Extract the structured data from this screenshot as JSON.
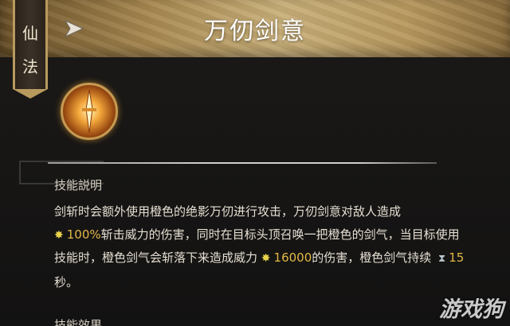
{
  "panel": {
    "title": "万仞剑意",
    "side_tab": {
      "char1": "仙",
      "char2": "法"
    }
  },
  "skill": {
    "icon": "sword-emblem-icon",
    "section_title": "技能説明",
    "desc": {
      "p1": "剑斩时会额外使用橙色的绝影万仞进行攻击，万仞剑意对敌人造成",
      "v1": "100%",
      "p2": "斩击威力的伤害，同时在目标头顶召唤一把橙色的剑气，当目标使用技能时，橙色剑气会斩落下来造成威力",
      "v2": "16000",
      "p3": "的伤害，橙色剑气持续",
      "v3": "15",
      "p4": "秒。"
    },
    "next_section": "技能效果"
  },
  "watermark": "游戏狗",
  "colors": {
    "gold": "#c9b07a",
    "highlight": "#e4b846",
    "text": "#e6dfd2"
  }
}
